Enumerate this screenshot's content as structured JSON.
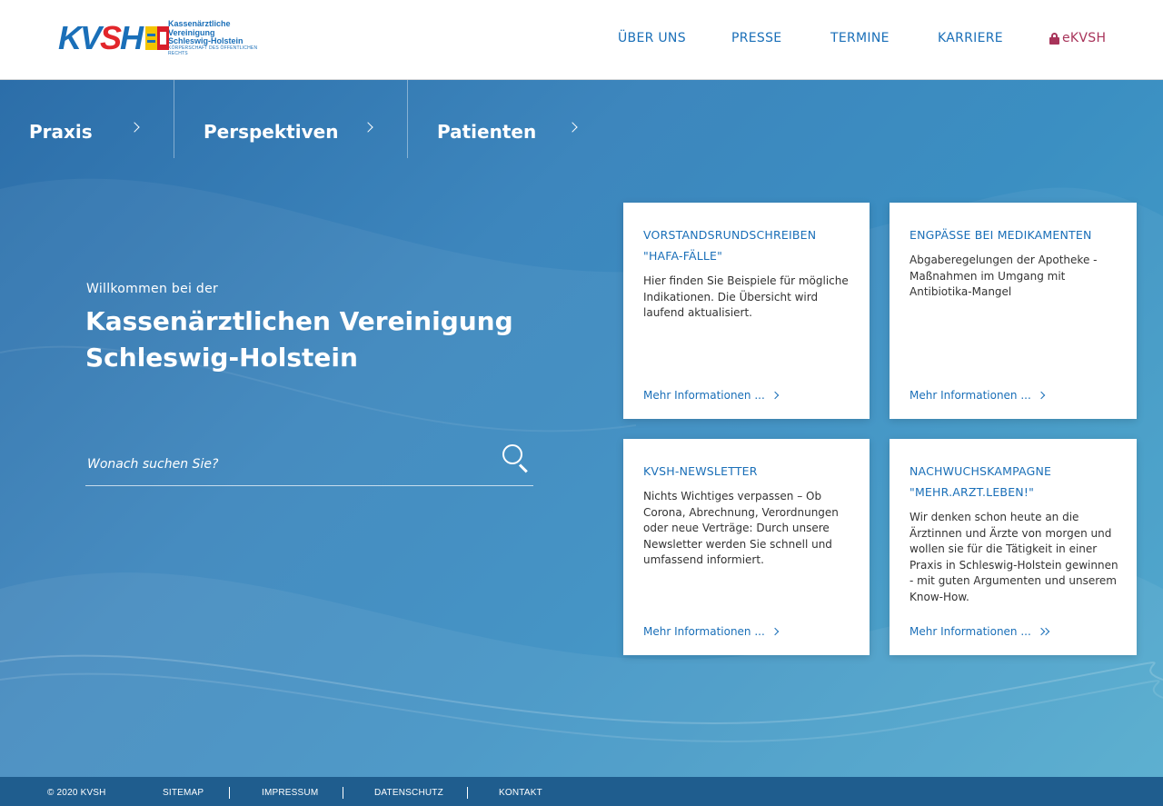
{
  "header": {
    "logo": {
      "mark_k": "KV",
      "mark_s": "S",
      "mark_h": "H",
      "line1": "Kassenärztliche Vereinigung",
      "line2": "Schleswig-Holstein",
      "line3": "KÖRPERSCHAFT DES ÖFFENTLICHEN RECHTS"
    },
    "nav": [
      {
        "label": "ÜBER UNS"
      },
      {
        "label": "PRESSE"
      },
      {
        "label": "TERMINE"
      },
      {
        "label": "KARRIERE"
      },
      {
        "label": "eKVSH",
        "icon": "lock-icon"
      }
    ]
  },
  "categories": [
    {
      "label": "Praxis"
    },
    {
      "label": "Perspektiven"
    },
    {
      "label": "Patienten"
    }
  ],
  "welcome": {
    "intro": "Willkommen bei der",
    "title": "Kassenärztlichen Vereinigung Schleswig-Holstein"
  },
  "search": {
    "placeholder": "Wonach suchen Sie?",
    "value": ""
  },
  "cards": [
    {
      "title": "VORSTANDSRUNDSCHREIBEN \"HAFA-FÄLLE\"",
      "text": "Hier finden Sie Beispiele für mögliche Indikationen. Die Übersicht wird laufend aktualisiert.",
      "link": "Mehr Informationen ..."
    },
    {
      "title": "ENGPÄSSE BEI MEDIKAMENTEN",
      "text": "Abgaberegelungen der Apotheke - Maßnahmen im Umgang mit Antibiotika-Mangel",
      "link": "Mehr Informationen ..."
    },
    {
      "title": "KVSH-NEWSLETTER",
      "text": "Nichts Wichtiges verpassen – Ob Corona, Abrechnung, Verordnungen oder neue Verträge: Durch unsere Newsletter werden Sie schnell und umfassend informiert.",
      "link": "Mehr Informationen ..."
    },
    {
      "title": "NACHWUCHSKAMPAGNE \"MEHR.ARZT.LEBEN!\"",
      "text": "Wir denken schon heute an die Ärztinnen und Ärzte von morgen und wollen sie für die Tätigkeit in einer Praxis in Schleswig-Holstein gewinnen - mit guten Argumenten und unserem Know-How.",
      "link": "Mehr Informationen ..."
    }
  ],
  "footer": {
    "copyright": "© 2020 KVSH",
    "links": [
      "SITEMAP",
      "IMPRESSUM",
      "DATENSCHUTZ",
      "KONTAKT"
    ]
  },
  "colors": {
    "brand_blue": "#1a6fb8",
    "ekvsh": "#a8345a",
    "footer_bg": "#1f5d8e"
  }
}
